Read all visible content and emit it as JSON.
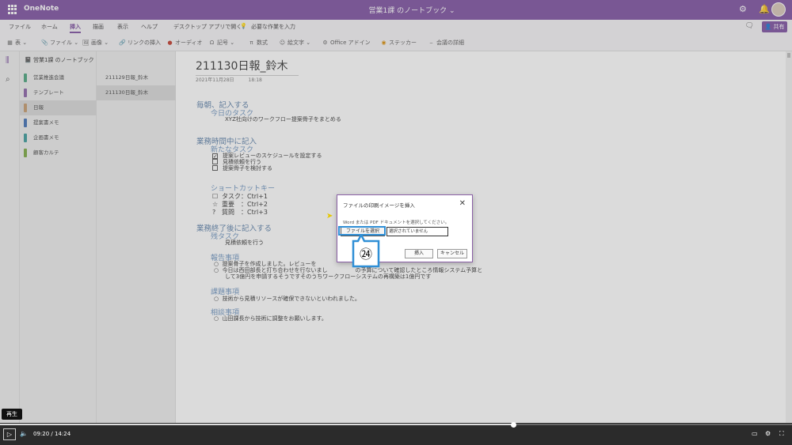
{
  "titlebar": {
    "app_name": "OneNote",
    "notebook_title": "営業1課 のノートブック",
    "settings_icon": "gear-icon",
    "bell_icon": "bell-icon"
  },
  "menu": {
    "tabs": [
      "ファイル",
      "ホーム",
      "挿入",
      "描画",
      "表示",
      "ヘルプ",
      "デスクトップ アプリで開く",
      "必要な作業を入力"
    ],
    "active_tab": "挿入",
    "share_label": "共有"
  },
  "ribbon": {
    "table": "表",
    "file": "ファイル",
    "image": "画像",
    "link": "リンクの挿入",
    "audio": "オーディオ",
    "symbol": "記号",
    "math": "数式",
    "sticky": "絵文字",
    "office_addins": "Office アドイン",
    "sticker": "ステッカー",
    "meeting": "会議の詳細"
  },
  "sidebar": {
    "notebook": "営業1課 のノートブック",
    "sections": [
      {
        "label": "営業推進会議",
        "color": "#4aa37d"
      },
      {
        "label": "テンプレート",
        "color": "#8a60a6"
      },
      {
        "label": "日報",
        "color": "#c49a6c"
      },
      {
        "label": "提案書メモ",
        "color": "#3f6fb5"
      },
      {
        "label": "企画書メモ",
        "color": "#3a9a9a"
      },
      {
        "label": "顧客カルテ",
        "color": "#7aa83f"
      }
    ],
    "selected_section": 2,
    "pages": [
      "211129日報_鈴木",
      "211130日報_鈴木"
    ],
    "selected_page": 1
  },
  "page": {
    "title": "211130日報_鈴木",
    "date": "2021年11月28日",
    "time": "18:18",
    "h_morning": "毎朝、記入する",
    "h_today": "今日のタスク",
    "today_line": "XYZ社向けのワークフロー提案骨子をまとめる",
    "h_business": "業務時間中に記入",
    "h_newtask": "新たなタスク",
    "tasks": [
      "提案レビューのスケジュールを設定する",
      "見積依頼を行う",
      "提案骨子を検討する"
    ],
    "h_shortcut": "ショートカットキー",
    "shortcuts": [
      {
        "sym": "☐",
        "text": "タスク：Ctrl+1"
      },
      {
        "sym": "☆",
        "text": "重要　：Ctrl+2"
      },
      {
        "sym": "?",
        "text": "質問　：Ctrl+3"
      }
    ],
    "h_end": "業務終了後に記入する",
    "h_remaining": "残タスク",
    "remaining_line": "見積依頼を行う",
    "h_report": "報告事項",
    "report_lines": [
      "提案骨子を作成しました。レビューを",
      "今日は西田部長と打ち合わせを行ないまし　　　　　の予算について確認したところ情報システム予算と",
      "して3億円を申請するそうですそのうちワークフローシステムの再構築は1億円です"
    ],
    "h_issue": "課題事項",
    "issue_line": "技術から見積リソースが確保できないといわれました。",
    "h_consult": "相談事項",
    "consult_line": "山田課長から技術に調整をお願いします。"
  },
  "dialog": {
    "title": "ファイルの印刷イメージを挿入",
    "instruction": "Word または PDF ドキュメントを選択してください。",
    "choose_file": "ファイルを選択",
    "no_file": "選択されていません",
    "insert": "挿入",
    "cancel": "キャンセル",
    "callout_number": "㉔",
    "callout_color": "#2f8fd6"
  },
  "video": {
    "tooltip": "再生",
    "current_time": "09:20",
    "total_time": "14:24",
    "progress": 0.649
  }
}
